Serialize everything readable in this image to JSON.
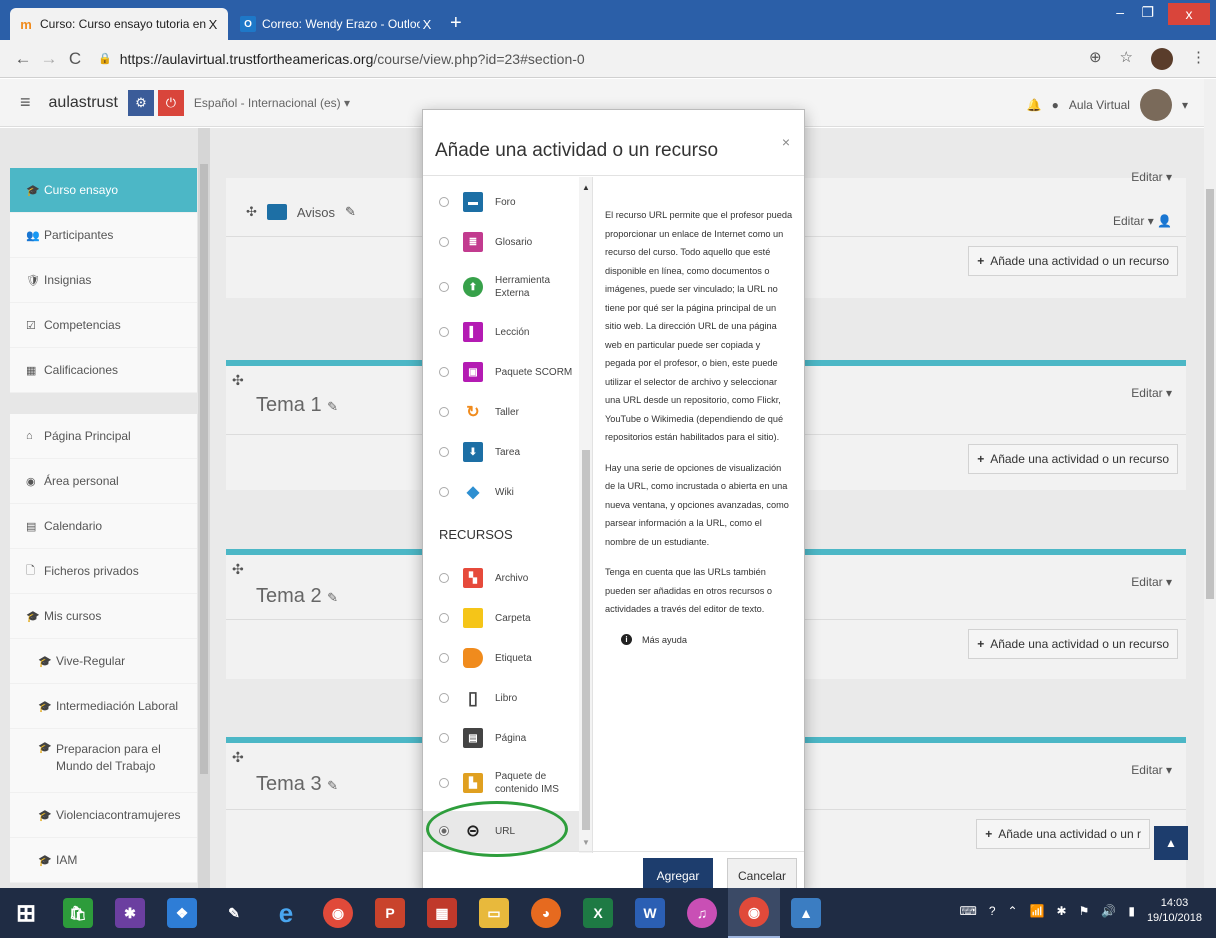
{
  "browser": {
    "tabs": [
      {
        "title": "Curso: Curso ensayo tutoria en e",
        "close": "X"
      },
      {
        "title": "Correo: Wendy Erazo - Outlook",
        "close": "X"
      }
    ],
    "new_tab": "+",
    "url_host": "https://aulavirtual.trustfortheamericas.org",
    "url_path": "/course/view.php?id=23#section-0"
  },
  "navbar": {
    "brand": "aulastrust",
    "language": "Español - Internacional (es) ▾",
    "user": "Aula Virtual"
  },
  "sidebar": {
    "course_items": [
      {
        "label": "Curso ensayo",
        "icon": "graduation-cap-icon",
        "glyph": "🎓"
      },
      {
        "label": "Participantes",
        "icon": "users-icon",
        "glyph": "👥"
      },
      {
        "label": "Insignias",
        "icon": "shield-icon",
        "glyph": "🛡"
      },
      {
        "label": "Competencias",
        "icon": "checkbox-icon",
        "glyph": "☑"
      },
      {
        "label": "Calificaciones",
        "icon": "table-icon",
        "glyph": "▦"
      }
    ],
    "site_items": [
      {
        "label": "Página Principal",
        "icon": "home-icon",
        "glyph": "⌂"
      },
      {
        "label": "Área personal",
        "icon": "dashboard-icon",
        "glyph": "◉"
      },
      {
        "label": "Calendario",
        "icon": "calendar-icon",
        "glyph": "▤"
      },
      {
        "label": "Ficheros privados",
        "icon": "file-icon",
        "glyph": "🗋"
      },
      {
        "label": "Mis cursos",
        "icon": "graduation-cap-icon",
        "glyph": "🎓"
      },
      {
        "label": "Vive-Regular",
        "icon": "graduation-cap-icon",
        "glyph": "🎓"
      },
      {
        "label": "Intermediación Laboral",
        "icon": "graduation-cap-icon",
        "glyph": "🎓"
      },
      {
        "label": "Preparacion para el\nMundo del Trabajo",
        "icon": "graduation-cap-icon",
        "glyph": "🎓"
      },
      {
        "label": "Violenciacontramujeres",
        "icon": "graduation-cap-icon",
        "glyph": "🎓"
      },
      {
        "label": "IAM",
        "icon": "graduation-cap-icon",
        "glyph": "🎓"
      }
    ]
  },
  "course": {
    "edit_label": "Editar",
    "add_label": "Añade una actividad o un recurso",
    "add_label_cut": "Añade una actividad o un r",
    "avisos": "Avisos",
    "sections": [
      "Tema 1",
      "Tema 2",
      "Tema 3"
    ]
  },
  "modal": {
    "title": "Añade una actividad o un recurso",
    "close": "×",
    "activities": [
      {
        "label": "Foro",
        "icon": "forum-icon",
        "color": "#1d6fa5",
        "glyph": "▬"
      },
      {
        "label": "Glosario",
        "icon": "glossary-icon",
        "color": "#c23b8f",
        "glyph": "≣"
      },
      {
        "label": "Herramienta\nExterna",
        "icon": "puzzle-icon",
        "color": "#37a14a",
        "glyph": "⬆"
      },
      {
        "label": "Lección",
        "icon": "lesson-icon",
        "color": "#b41bb3",
        "glyph": "▌"
      },
      {
        "label": "Paquete SCORM",
        "icon": "scorm-icon",
        "color": "#b41bb3",
        "glyph": "▣"
      },
      {
        "label": "Taller",
        "icon": "workshop-icon",
        "color": "#f08b1d",
        "glyph": "↻"
      },
      {
        "label": "Tarea",
        "icon": "assignment-icon",
        "color": "#1d6fa5",
        "glyph": "⬇"
      },
      {
        "label": "Wiki",
        "icon": "wiki-icon",
        "color": "#2e8fd1",
        "glyph": "◆"
      }
    ],
    "resources_header": "RECURSOS",
    "resources": [
      {
        "label": "Archivo",
        "icon": "file-icon",
        "color": "#e64a3b",
        "glyph": "▚"
      },
      {
        "label": "Carpeta",
        "icon": "folder-icon",
        "color": "#f5c518",
        "glyph": ""
      },
      {
        "label": "Etiqueta",
        "icon": "label-icon",
        "color": "#f08b1d",
        "glyph": "◣"
      },
      {
        "label": "Libro",
        "icon": "book-icon",
        "color": "#444444",
        "glyph": "▯"
      },
      {
        "label": "Página",
        "icon": "page-icon",
        "color": "#444444",
        "glyph": "▤"
      },
      {
        "label": "Paquete de\ncontenido IMS",
        "icon": "ims-icon",
        "color": "#e0a020",
        "glyph": "▙"
      },
      {
        "label": "URL",
        "icon": "link-icon",
        "color": "#222222",
        "glyph": "⊝"
      }
    ],
    "help": [
      "El recurso URL permite que el profesor pueda proporcionar un enlace de Internet como un recurso del curso. Todo aquello que esté disponible en línea, como documentos o imágenes, puede ser vinculado; la URL no tiene por qué ser la página principal de un sitio web. La dirección URL de una página web en particular puede ser copiada y pegada por el profesor, o bien, este puede utilizar el selector de archivo y seleccionar una URL desde un repositorio, como Flickr, YouTube o Wikimedia (dependiendo de qué repositorios están habilitados para el sitio).",
      "Hay una serie de opciones de visualización de la URL, como incrustada o abierta en una nueva ventana, y opciones avanzadas, como parsear información a la URL, como el nombre de un estudiante.",
      "Tenga en cuenta que las URLs también pueden ser añadidas en otros recursos o actividades a través del editor de texto."
    ],
    "more_help": "Más ayuda",
    "add_button": "Agregar",
    "cancel_button": "Cancelar"
  },
  "taskbar": {
    "apps": [
      {
        "name": "start-icon",
        "color": "#1f2c44",
        "glyph": "⊞"
      },
      {
        "name": "store-icon",
        "color": "#2d9c3b",
        "glyph": "🛍"
      },
      {
        "name": "paint-app-icon",
        "color": "#6b3fa0",
        "glyph": "✱"
      },
      {
        "name": "dropbox-icon",
        "color": "#2e7dd6",
        "glyph": "❖"
      },
      {
        "name": "pen-icon",
        "color": "#55606e",
        "glyph": "✎"
      },
      {
        "name": "internet-explorer-icon",
        "color": "#1e78c8",
        "glyph": "e"
      },
      {
        "name": "chrome-icon",
        "color": "#e04a3a",
        "glyph": "◉"
      },
      {
        "name": "powerpoint-icon",
        "color": "#c9432c",
        "glyph": "P"
      },
      {
        "name": "calculator-icon",
        "color": "#c0392b",
        "glyph": "▦"
      },
      {
        "name": "file-explorer-icon",
        "color": "#e8b93c",
        "glyph": "▭"
      },
      {
        "name": "firefox-icon",
        "color": "#e66a1f",
        "glyph": "◕"
      },
      {
        "name": "excel-icon",
        "color": "#1e7a44",
        "glyph": "X"
      },
      {
        "name": "word-icon",
        "color": "#2b5fb4",
        "glyph": "W"
      },
      {
        "name": "itunes-icon",
        "color": "#c94fb5",
        "glyph": "♫"
      },
      {
        "name": "chrome-active-icon",
        "color": "#e04a3a",
        "glyph": "◉"
      },
      {
        "name": "photos-icon",
        "color": "#3b7dc2",
        "glyph": "▲"
      }
    ],
    "time": "14:03",
    "date": "19/10/2018"
  }
}
